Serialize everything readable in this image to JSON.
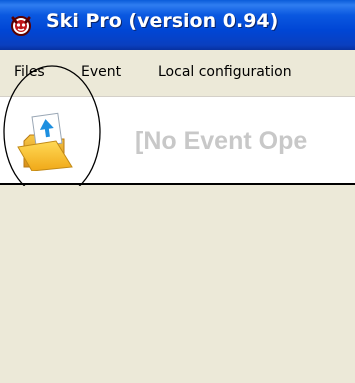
{
  "window": {
    "title": "Ski Pro (version 0.94)",
    "app_icon": "ski-pro-app-icon"
  },
  "menubar": {
    "items": [
      {
        "label": "Files"
      },
      {
        "label": "Event"
      },
      {
        "label": "Local configuration"
      }
    ]
  },
  "toolbar": {
    "open_event_icon": "open-folder-icon",
    "status_text": "[No Event Ope"
  },
  "colors": {
    "titlebar": "#0046d5",
    "window_background": "#ece9d8",
    "status_text": "#c8c8c8"
  }
}
